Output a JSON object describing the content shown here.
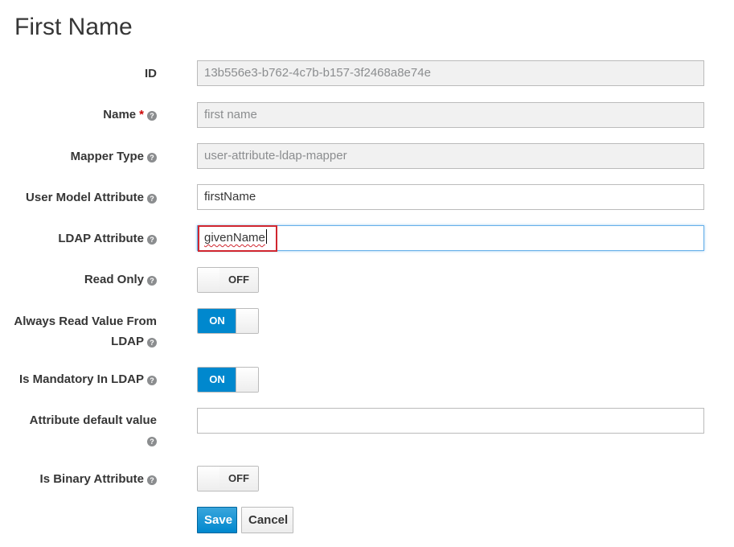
{
  "page": {
    "title": "First Name"
  },
  "fields": {
    "id": {
      "label": "ID",
      "value": "13b556e3-b762-4c7b-b157-3f2468a8e74e"
    },
    "name": {
      "label": "Name",
      "required_mark": "*",
      "value": "first name"
    },
    "mapper_type": {
      "label": "Mapper Type",
      "value": "user-attribute-ldap-mapper"
    },
    "user_model_attribute": {
      "label": "User Model Attribute",
      "value": "firstName"
    },
    "ldap_attribute": {
      "label": "LDAP Attribute",
      "value": "givenName"
    },
    "read_only": {
      "label": "Read Only",
      "state": "OFF"
    },
    "always_read": {
      "label_line1": "Always Read Value From",
      "label_line2": "LDAP",
      "state": "ON"
    },
    "is_mandatory": {
      "label": "Is Mandatory In LDAP",
      "state": "ON"
    },
    "attribute_default": {
      "label": "Attribute default value",
      "value": ""
    },
    "is_binary": {
      "label": "Is Binary Attribute",
      "state": "OFF"
    }
  },
  "actions": {
    "save_label": "Save",
    "cancel_label": "Cancel"
  },
  "icons": {
    "help": "question-circle-icon"
  },
  "colors": {
    "accent": "#0088ce",
    "highlight": "#d0262f",
    "required": "#cc0000"
  }
}
